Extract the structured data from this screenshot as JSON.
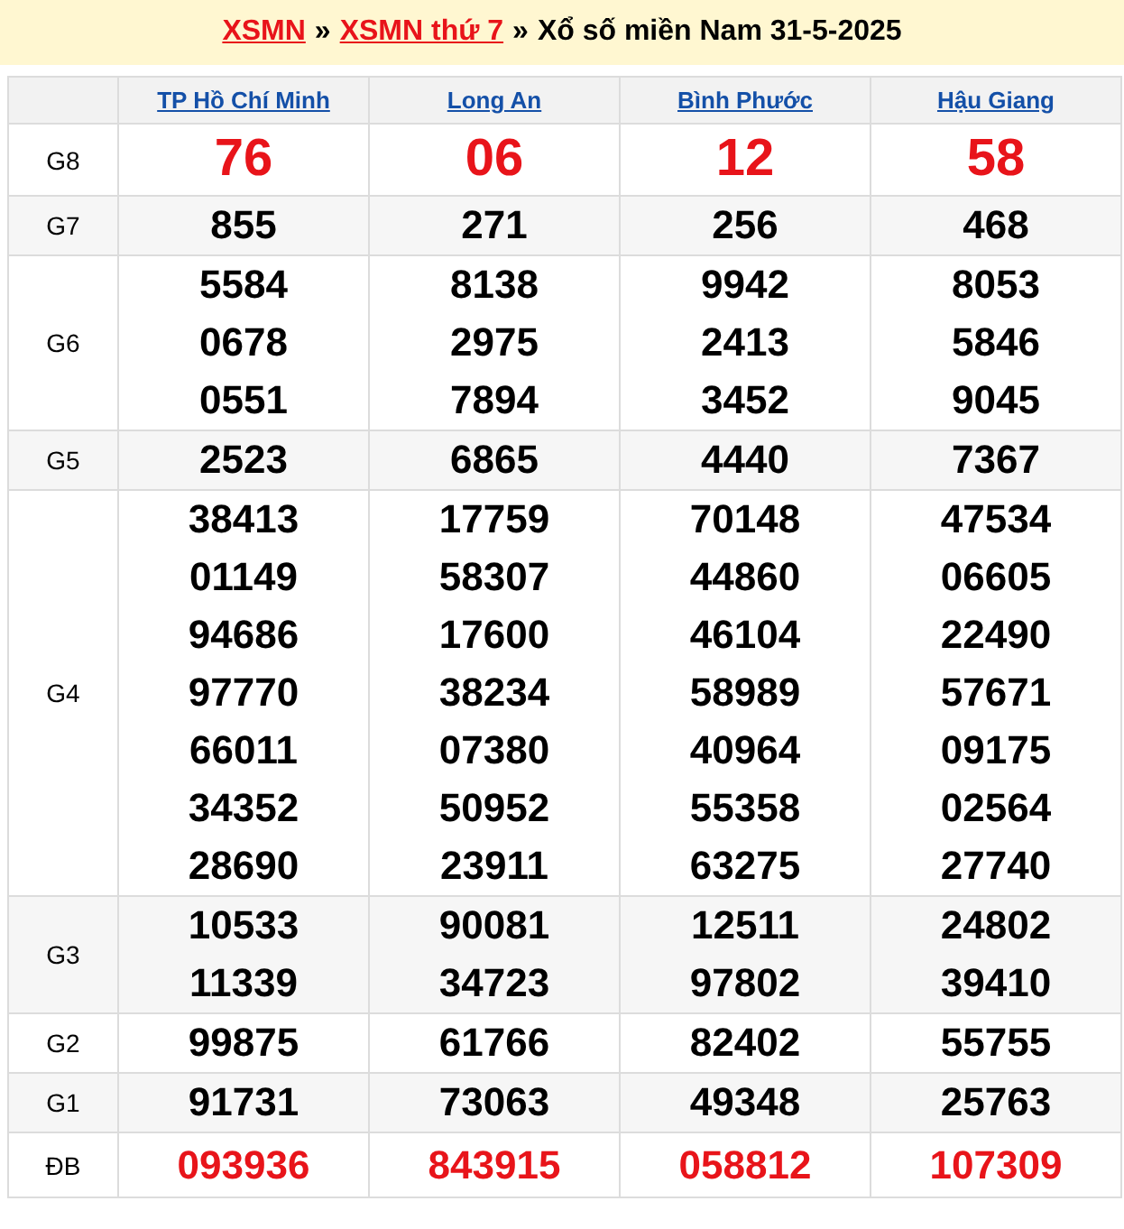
{
  "breadcrumb": [
    {
      "kind": "link",
      "text": "XSMN"
    },
    {
      "kind": "separator",
      "text": "»"
    },
    {
      "kind": "link",
      "text": "XSMN thứ 7"
    },
    {
      "kind": "separator",
      "text": "»"
    },
    {
      "kind": "current",
      "text": "Xổ số miền Nam 31-5-2025"
    }
  ],
  "table": {
    "provinces": [
      "TP Hồ Chí Minh",
      "Long An",
      "Bình Phước",
      "Hậu Giang"
    ],
    "rows": [
      {
        "prize": "G8",
        "kind": "large",
        "cells": [
          [
            "76"
          ],
          [
            "06"
          ],
          [
            "12"
          ],
          [
            "58"
          ]
        ]
      },
      {
        "prize": "G7",
        "kind": "normal",
        "cells": [
          [
            "855"
          ],
          [
            "271"
          ],
          [
            "256"
          ],
          [
            "468"
          ]
        ]
      },
      {
        "prize": "G6",
        "kind": "normal",
        "cells": [
          [
            "5584",
            "0678",
            "0551"
          ],
          [
            "8138",
            "2975",
            "7894"
          ],
          [
            "9942",
            "2413",
            "3452"
          ],
          [
            "8053",
            "5846",
            "9045"
          ]
        ]
      },
      {
        "prize": "G5",
        "kind": "normal",
        "cells": [
          [
            "2523"
          ],
          [
            "6865"
          ],
          [
            "4440"
          ],
          [
            "7367"
          ]
        ]
      },
      {
        "prize": "G4",
        "kind": "normal",
        "cells": [
          [
            "38413",
            "01149",
            "94686",
            "97770",
            "66011",
            "34352",
            "28690"
          ],
          [
            "17759",
            "58307",
            "17600",
            "38234",
            "07380",
            "50952",
            "23911"
          ],
          [
            "70148",
            "44860",
            "46104",
            "58989",
            "40964",
            "55358",
            "63275"
          ],
          [
            "47534",
            "06605",
            "22490",
            "57671",
            "09175",
            "02564",
            "27740"
          ]
        ]
      },
      {
        "prize": "G3",
        "kind": "normal",
        "cells": [
          [
            "10533",
            "11339"
          ],
          [
            "90081",
            "34723"
          ],
          [
            "12511",
            "97802"
          ],
          [
            "24802",
            "39410"
          ]
        ]
      },
      {
        "prize": "G2",
        "kind": "normal",
        "cells": [
          [
            "99875"
          ],
          [
            "61766"
          ],
          [
            "82402"
          ],
          [
            "55755"
          ]
        ]
      },
      {
        "prize": "G1",
        "kind": "normal",
        "cells": [
          [
            "91731"
          ],
          [
            "73063"
          ],
          [
            "49348"
          ],
          [
            "25763"
          ]
        ]
      },
      {
        "prize": "ĐB",
        "kind": "special",
        "cells": [
          [
            "093936"
          ],
          [
            "843915"
          ],
          [
            "058812"
          ],
          [
            "107309"
          ]
        ]
      }
    ]
  }
}
